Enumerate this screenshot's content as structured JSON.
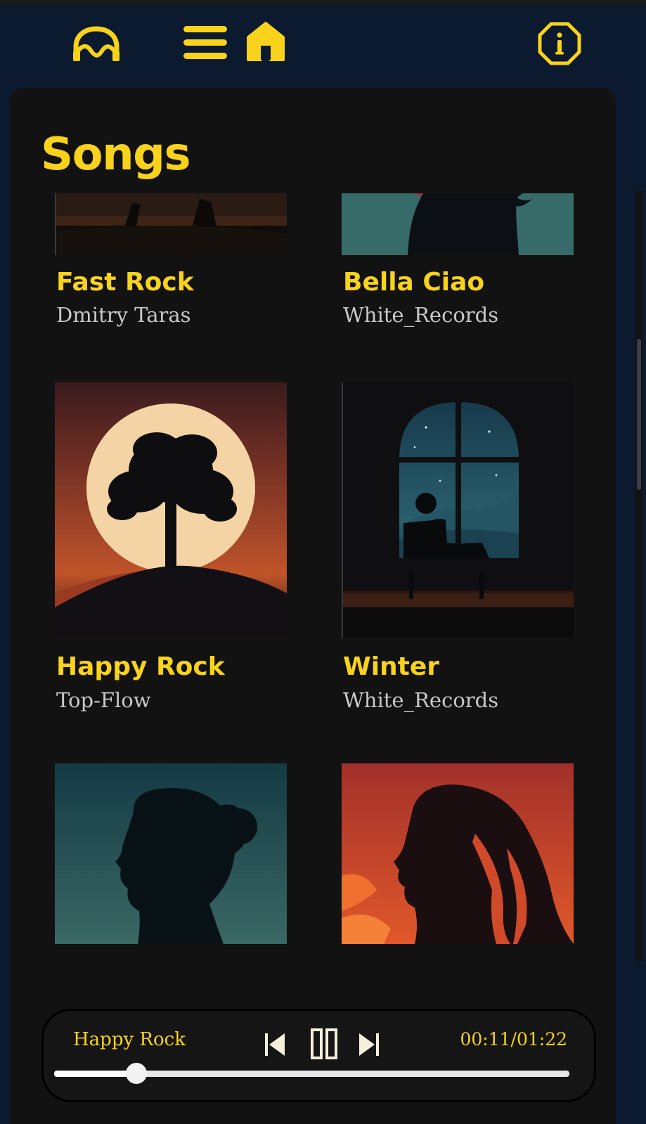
{
  "header": {
    "icons": [
      "headphones-icon",
      "menu-icon",
      "home-icon",
      "info-icon"
    ]
  },
  "page": {
    "title": "Songs"
  },
  "songs": [
    {
      "title": "Fast Rock",
      "artist": "Dmitry Taras",
      "art": "silhouette-on-rock-dusk"
    },
    {
      "title": "Bella Ciao",
      "artist": "White_Records",
      "art": "teal-silhouette"
    },
    {
      "title": "Happy Rock",
      "artist": "Top-Flow",
      "art": "tree-moon-sunset"
    },
    {
      "title": "Winter",
      "artist": "White_Records",
      "art": "person-at-night-window"
    },
    {
      "title": "",
      "artist": "",
      "art": "woman-bun-profile-teal"
    },
    {
      "title": "",
      "artist": "",
      "art": "woman-hair-profile-red"
    }
  ],
  "player": {
    "title": "Happy Rock",
    "time": "00:11/01:22",
    "progress": 0.159,
    "controls": [
      "previous-icon",
      "pause-icon",
      "next-icon"
    ]
  },
  "colors": {
    "accent": "#f9d21b",
    "background": "#0b1a2e",
    "panel": "#121212",
    "artist_text": "#c8c8c8"
  }
}
